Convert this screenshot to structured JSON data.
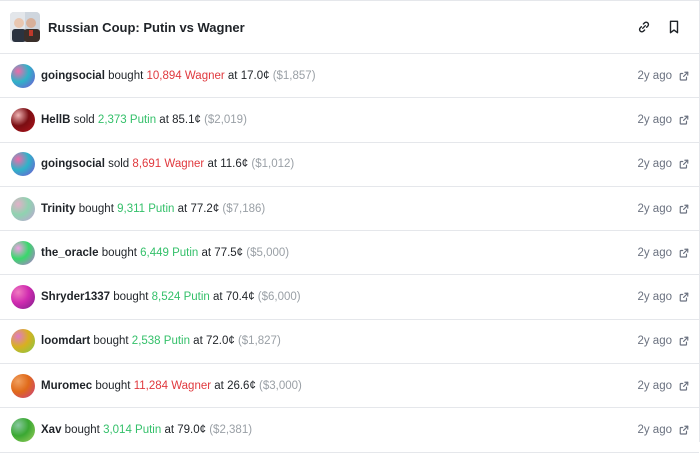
{
  "header": {
    "title": "Russian Coup: Putin vs Wagner",
    "icons": [
      "link-icon",
      "bookmark-icon"
    ]
  },
  "colors": {
    "wagner": "#e0393e",
    "putin": "#34c06a",
    "muted": "#9aa0a6",
    "border": "#e5e7eb"
  },
  "trades": [
    {
      "user": "goingsocial",
      "action": "bought",
      "shares": "10,894 Wagner",
      "outcome": "Wagner",
      "price": "17.0¢",
      "amount": "($1,857)",
      "time": "2y ago",
      "avatar": [
        "#2fb3c8",
        "#7b4fd6",
        "#f06aa8"
      ]
    },
    {
      "user": "HellB",
      "action": "sold",
      "shares": "2,373 Putin",
      "outcome": "Putin",
      "price": "85.1¢",
      "amount": "($2,019)",
      "time": "2y ago",
      "avatar": [
        "#7a0d12",
        "#b0141c",
        "#f0b4b4"
      ]
    },
    {
      "user": "goingsocial",
      "action": "sold",
      "shares": "8,691 Wagner",
      "outcome": "Wagner",
      "price": "11.6¢",
      "amount": "($1,012)",
      "time": "2y ago",
      "avatar": [
        "#2fb3c8",
        "#7b4fd6",
        "#f06aa8"
      ]
    },
    {
      "user": "Trinity",
      "action": "bought",
      "shares": "9,311 Putin",
      "outcome": "Putin",
      "price": "77.2¢",
      "amount": "($7,186)",
      "time": "2y ago",
      "avatar": [
        "#8fd3b0",
        "#c4a0d8",
        "#e2b0c8"
      ]
    },
    {
      "user": "the_oracle",
      "action": "bought",
      "shares": "6,449 Putin",
      "outcome": "Putin",
      "price": "77.5¢",
      "amount": "($5,000)",
      "time": "2y ago",
      "avatar": [
        "#38d86b",
        "#c86be0",
        "#f2a0e6"
      ]
    },
    {
      "user": "Shryder1337",
      "action": "bought",
      "shares": "8,524 Putin",
      "outcome": "Putin",
      "price": "70.4¢",
      "amount": "($6,000)",
      "time": "2y ago",
      "avatar": [
        "#d02bb0",
        "#7a1e8a",
        "#f07ac0"
      ]
    },
    {
      "user": "loomdart",
      "action": "bought",
      "shares": "2,538 Putin",
      "outcome": "Putin",
      "price": "72.0¢",
      "amount": "($1,827)",
      "time": "2y ago",
      "avatar": [
        "#d8b020",
        "#7dcb4a",
        "#e07ac8"
      ]
    },
    {
      "user": "Muromec",
      "action": "bought",
      "shares": "11,284 Wagner",
      "outcome": "Wagner",
      "price": "26.6¢",
      "amount": "($3,000)",
      "time": "2y ago",
      "avatar": [
        "#e06a1a",
        "#c83d8a",
        "#f0a060"
      ]
    },
    {
      "user": "Xav",
      "action": "bought",
      "shares": "3,014 Putin",
      "outcome": "Putin",
      "price": "79.0¢",
      "amount": "($2,381)",
      "time": "2y ago",
      "avatar": [
        "#3aa832",
        "#a0d060",
        "#88c8a0"
      ]
    }
  ]
}
